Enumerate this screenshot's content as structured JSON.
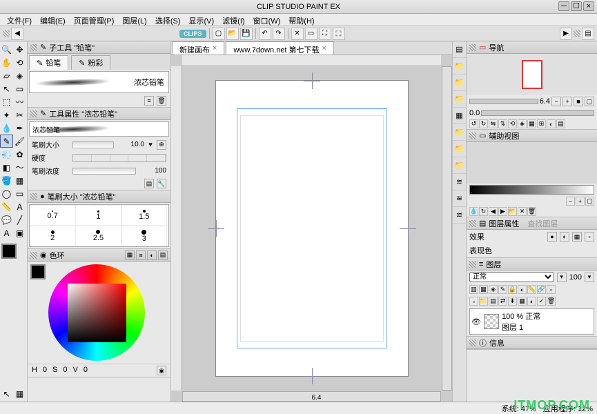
{
  "titlebar": {
    "title": "CLIP STUDIO PAINT EX"
  },
  "menu": [
    "文件(F)",
    "编辑(E)",
    "页面管理(P)",
    "图层(L)",
    "选择(S)",
    "显示(V)",
    "滤镜(I)",
    "窗口(W)",
    "帮助(H)"
  ],
  "clips_logo": "CLIPS",
  "subtool": {
    "title": "子工具 \"铅笔\"",
    "tabs": [
      {
        "label": "铅笔",
        "icon": "✎"
      },
      {
        "label": "粉彩",
        "icon": "✎"
      }
    ],
    "preview_label": "浓芯铅笔"
  },
  "toolprop": {
    "title": "工具属性 \"浓芯铅笔\"",
    "name": "浓芯铅笔",
    "rows": [
      {
        "label": "笔刷大小",
        "value": "10.0"
      },
      {
        "label": "硬度",
        "value": ""
      },
      {
        "label": "笔刷浓度",
        "value": "100"
      }
    ]
  },
  "brushsize": {
    "title": "笔刷大小 \"浓芯铅笔\"",
    "sizes": [
      {
        "label": "0.7",
        "d": 2
      },
      {
        "label": "1",
        "d": 3
      },
      {
        "label": "1.5",
        "d": 4
      },
      {
        "label": "2",
        "d": 5
      },
      {
        "label": "2.5",
        "d": 6
      },
      {
        "label": "3",
        "d": 7
      }
    ]
  },
  "color": {
    "title": "色环",
    "hsv": {
      "h": "H",
      "hv": "0",
      "s": "S",
      "sv": "0",
      "v": "V",
      "vv": "0"
    }
  },
  "docs": [
    "新建画布",
    "www.7down.net 第七下载"
  ],
  "navigator": {
    "title": "导航",
    "zoom": "6.4",
    "value": "0.0"
  },
  "subview": {
    "title": "辅助视图"
  },
  "layerprop": {
    "title": "图层属性",
    "tab2": "查找图层",
    "effect": "效果",
    "expression": "表现色"
  },
  "layers": {
    "title": "图层",
    "blend": "正常",
    "opacity": "100",
    "item": {
      "opacity": "100 %",
      "blend": "正常",
      "name": "图层 1"
    }
  },
  "info": {
    "title": "信息"
  },
  "status": {
    "sys": "系统: 47%",
    "app": "应用程序: 12%",
    "zoom": "6.4"
  },
  "watermark": "ITMOP.COM"
}
